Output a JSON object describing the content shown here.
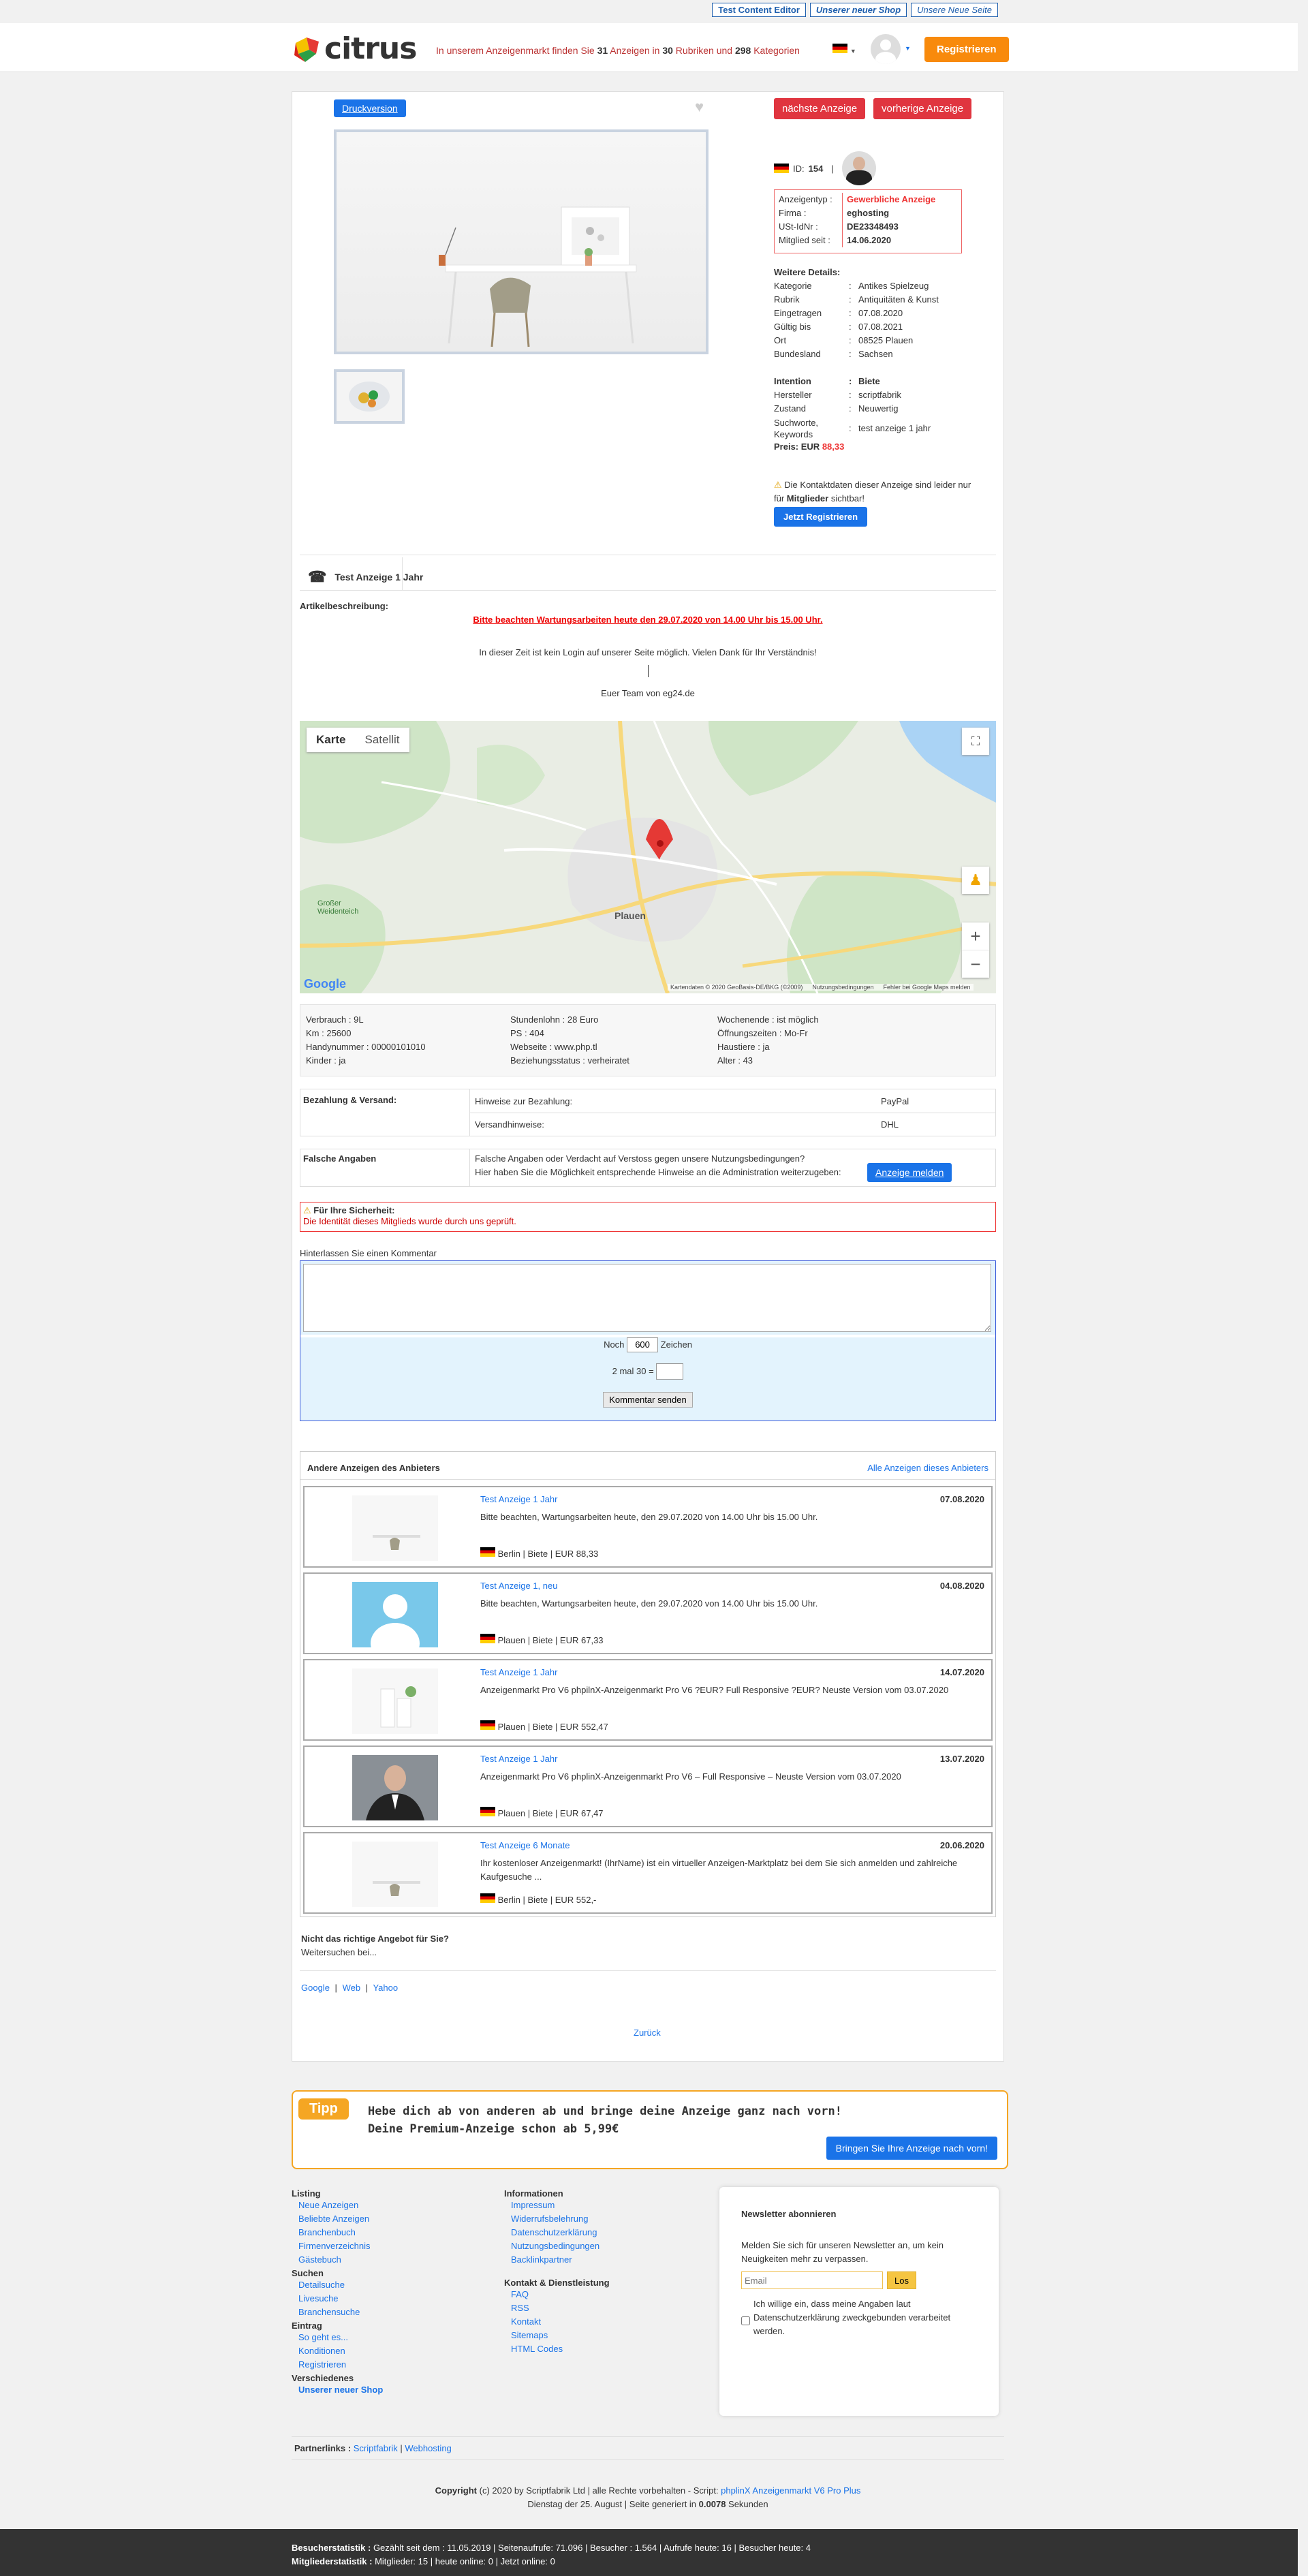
{
  "top_links": [
    "Test Content Editor",
    "Unserer neuer Shop",
    "Unsere Neue Seite"
  ],
  "header": {
    "logo_text": "citrus",
    "info_pre": "In unserem Anzeigenmarkt finden Sie ",
    "ads_count": "31",
    "info_mid1": " Anzeigen in ",
    "rubrics_count": "30",
    "info_mid2": " Rubriken und ",
    "cat_count": "298",
    "info_post": " Kategorien",
    "register_label": "Registrieren"
  },
  "ad": {
    "print_label": "Druckversion",
    "next_label": "nächste Anzeige",
    "prev_label": "vorherige Anzeige",
    "id_label": "ID:",
    "id_value": "154",
    "type_rows": [
      {
        "k": "Anzeigentyp :",
        "v": "Gewerbliche Anzeige"
      },
      {
        "k": "Firma :",
        "v": "eghosting"
      },
      {
        "k": "USt-IdNr :",
        "v": "DE23348493"
      },
      {
        "k": "Mitglied seit :",
        "v": "14.06.2020"
      }
    ],
    "details_title": "Weitere Details:",
    "details": [
      {
        "k": "Kategorie",
        "v": "Antikes Spielzeug"
      },
      {
        "k": "Rubrik",
        "v": "Antiquitäten & Kunst"
      },
      {
        "k": "Eingetragen",
        "v": "07.08.2020"
      },
      {
        "k": "Gültig bis",
        "v": "07.08.2021"
      },
      {
        "k": "Ort",
        "v": "08525 Plauen"
      },
      {
        "k": "Bundesland",
        "v": "Sachsen"
      }
    ],
    "details2": [
      {
        "k": "Intention",
        "v": "Biete"
      },
      {
        "k": "Hersteller",
        "v": "scriptfabrik"
      },
      {
        "k": "Zustand",
        "v": "Neuwertig"
      },
      {
        "k": "Suchworte, Keywords",
        "v": "test anzeige 1 jahr"
      }
    ],
    "price_label": "Preis: EUR",
    "price_value": "88,33",
    "contact_note_pre": "Die Kontaktdaten dieser Anzeige sind leider nur für ",
    "contact_note_bold": "Mitglieder",
    "contact_note_post": " sichtbar!",
    "register_now": "Jetzt Registrieren",
    "title": "Test Anzeige 1 Jahr",
    "desc_label": "Artikelbeschreibung:",
    "warning": "Bitte beachten  Wartungsarbeiten heute  den 29.07.2020 von 14.00 Uhr bis 15.00 Uhr.",
    "desc_line1": "In dieser Zeit ist kein Login auf unserer Seite möglich. Vielen Dank für Ihr Verständnis!",
    "desc_line2": "Euer Team von eg24.de"
  },
  "map": {
    "tab_map": "Karte",
    "tab_sat": "Satellit",
    "city": "Plauen",
    "lake": "Großer Weidenteich",
    "attribution": "Kartendaten © 2020 GeoBasis-DE/BKG (©2009)",
    "terms": "Nutzungsbedingungen",
    "report": "Fehler bei Google Maps melden",
    "google": "Google"
  },
  "props": [
    [
      "Verbrauch : 9L",
      "Stundenlohn : 28 Euro",
      "Wochenende : ist möglich"
    ],
    [
      "Km : 25600",
      "PS : 404",
      "Öffnungszeiten : Mo-Fr"
    ],
    [
      "Handynummer : 00000101010",
      "Webseite : www.php.tl",
      "Haustiere : ja"
    ],
    [
      "Kinder : ja",
      "Beziehungsstatus : verheiratet",
      "Alter : 43"
    ]
  ],
  "payment": {
    "label": "Bezahlung & Versand:",
    "row1_k": "Hinweise zur Bezahlung:",
    "row1_v": "PayPal",
    "row2_k": "Versandhinweise:",
    "row2_v": "DHL"
  },
  "false_info": {
    "label": "Falsche Angaben",
    "line1": "Falsche Angaben oder Verdacht auf Verstoss gegen unsere Nutzungsbedingungen?",
    "line2": "Hier haben Sie die Möglichkeit entsprechende Hinweise an die Administration weiterzugeben:",
    "button": "Anzeige melden"
  },
  "security": {
    "title": "Für Ihre Sicherheit:",
    "text": "Die Identität dieses Mitglieds wurde durch uns geprüft."
  },
  "comment": {
    "label": "Hinterlassen Sie einen Kommentar",
    "noch": "Noch",
    "chars": "600",
    "zeichen": "Zeichen",
    "captcha": "2 mal 30 =",
    "submit": "Kommentar senden"
  },
  "other_ads": {
    "title": "Andere Anzeigen des Anbieters",
    "all_link": "Alle Anzeigen dieses Anbieters",
    "items": [
      {
        "title": "Test Anzeige 1 Jahr",
        "date": "07.08.2020",
        "desc": "Bitte beachten, Wartungsarbeiten heute, den 29.07.2020 von 14.00 Uhr bis 15.00 Uhr.",
        "meta": "Berlin | Biete | EUR 88,33"
      },
      {
        "title": "Test Anzeige 1, neu",
        "date": "04.08.2020",
        "desc": "Bitte beachten, Wartungsarbeiten heute, den 29.07.2020 von 14.00 Uhr bis 15.00 Uhr.",
        "meta": "Plauen | Biete | EUR 67,33"
      },
      {
        "title": "Test Anzeige 1 Jahr",
        "date": "14.07.2020",
        "desc": "Anzeigenmarkt Pro V6 phpilnX-Anzeigenmarkt Pro V6 ?EUR? Full Responsive ?EUR? Neuste Version vom 03.07.2020",
        "meta": "Plauen | Biete | EUR 552,47"
      },
      {
        "title": "Test Anzeige 1 Jahr",
        "date": "13.07.2020",
        "desc": "Anzeigenmarkt Pro V6 phplinX-Anzeigenmarkt Pro V6 – Full Responsive – Neuste Version vom 03.07.2020",
        "meta": "Plauen | Biete | EUR 67,47"
      },
      {
        "title": "Test Anzeige 6 Monate",
        "date": "20.06.2020",
        "desc": "Ihr kostenloser Anzeigenmarkt! (IhrName) ist ein virtueller Anzeigen-Marktplatz bei dem Sie sich anmelden und zahlreiche Kaufgesuche ...",
        "meta": "Berlin | Biete | EUR 552,-"
      }
    ]
  },
  "not_right": {
    "title": "Nicht das richtige Angebot für Sie?",
    "sub": "Weitersuchen bei...",
    "links": [
      "Google",
      "Web",
      "Yahoo"
    ],
    "back": "Zurück"
  },
  "tipp": {
    "badge": "Tipp",
    "line1": "Hebe dich ab von anderen ab und bringe deine Anzeige ganz nach vorn!",
    "line2": "Deine Premium-Anzeige schon ab 5,99€",
    "button": "Bringen Sie Ihre Anzeige nach vorn!"
  },
  "footer": {
    "col1": [
      {
        "h": "Listing",
        "links": [
          "Neue Anzeigen",
          "Beliebte Anzeigen",
          "Branchenbuch",
          "Firmenverzeichnis",
          "Gästebuch"
        ]
      },
      {
        "h": "Suchen",
        "links": [
          "Detailsuche",
          "Livesuche",
          "Branchensuche"
        ]
      },
      {
        "h": "Eintrag",
        "links": [
          "So geht es...",
          "Konditionen",
          "Registrieren"
        ]
      },
      {
        "h": "Verschiedenes",
        "links": [
          "Unserer neuer Shop"
        ]
      }
    ],
    "col2": [
      {
        "h": "Informationen",
        "links": [
          "Impressum",
          "Widerrufsbelehrung",
          "Datenschutzerklärung",
          "Nutzungsbedingungen",
          "Backlinkpartner"
        ]
      },
      {
        "h": "Kontakt & Dienstleistung",
        "links": [
          "FAQ",
          "RSS",
          "Kontakt",
          "Sitemaps",
          "HTML Codes"
        ]
      }
    ],
    "newsletter_title": "Newsletter abonnieren",
    "newsletter_text": "Melden Sie sich für unseren Newsletter an, um kein Neuigkeiten mehr zu verpassen.",
    "email_placeholder": "Email",
    "go": "Los",
    "consent": "Ich willige ein, dass meine Angaben laut Datenschutzerklärung zweckgebunden verarbeitet werden.",
    "partner_label": "Partnerlinks :",
    "partners": [
      "Scriptfabrik",
      "Webhosting"
    ],
    "copyright_pre": "Copyright",
    "copyright_text": " (c) 2020 by Scriptfabrik Ltd | alle Rechte vorbehalten - Script: ",
    "copyright_link": "phplinX Anzeigenmarkt V6 Pro Plus",
    "generated_pre": "Dienstag der 25. August | Seite generiert in ",
    "generated_val": "0.0078",
    "generated_post": " Sekunden"
  },
  "stats": {
    "line1_label": "Besucherstatistik :",
    "line1": " Gezählt seit dem : 11.05.2019 | Seitenaufrufe: 71.096 | Besucher : 1.564 | Aufrufe heute: 16 | Besucher heute: 4",
    "line2_label": "Mitgliederstatistik :",
    "line2": " Mitglieder: 15 | heute online: 0 | Jetzt online: 0"
  }
}
